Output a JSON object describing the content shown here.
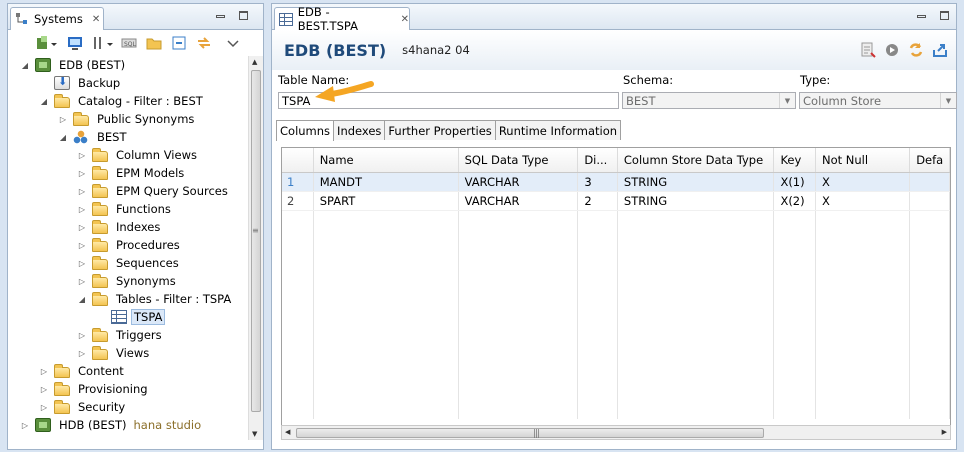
{
  "systems_view": {
    "tab_label": "Systems",
    "tree": [
      {
        "label": "EDB (BEST)",
        "level": 0,
        "icon": "database-icon",
        "toggle": "expanded"
      },
      {
        "label": "Backup",
        "level": 1,
        "icon": "backup-icon",
        "toggle": "none"
      },
      {
        "label": "Catalog - Filter : BEST",
        "level": 1,
        "icon": "folder-icon",
        "toggle": "expanded"
      },
      {
        "label": "Public Synonyms",
        "level": 2,
        "icon": "folder-icon",
        "toggle": "collapsed"
      },
      {
        "label": "BEST",
        "level": 2,
        "icon": "schema-icon",
        "toggle": "expanded"
      },
      {
        "label": "Column Views",
        "level": 3,
        "icon": "folder-icon",
        "toggle": "collapsed"
      },
      {
        "label": "EPM Models",
        "level": 3,
        "icon": "folder-icon",
        "toggle": "collapsed"
      },
      {
        "label": "EPM Query Sources",
        "level": 3,
        "icon": "folder-icon",
        "toggle": "collapsed"
      },
      {
        "label": "Functions",
        "level": 3,
        "icon": "folder-icon",
        "toggle": "collapsed"
      },
      {
        "label": "Indexes",
        "level": 3,
        "icon": "folder-icon",
        "toggle": "collapsed"
      },
      {
        "label": "Procedures",
        "level": 3,
        "icon": "folder-icon",
        "toggle": "collapsed"
      },
      {
        "label": "Sequences",
        "level": 3,
        "icon": "folder-icon",
        "toggle": "collapsed"
      },
      {
        "label": "Synonyms",
        "level": 3,
        "icon": "folder-icon",
        "toggle": "collapsed"
      },
      {
        "label": "Tables - Filter : TSPA",
        "level": 3,
        "icon": "folder-icon",
        "toggle": "expanded"
      },
      {
        "label": "TSPA",
        "level": 4,
        "icon": "table-icon",
        "toggle": "none",
        "selected": true
      },
      {
        "label": "Triggers",
        "level": 3,
        "icon": "folder-icon",
        "toggle": "collapsed"
      },
      {
        "label": "Views",
        "level": 3,
        "icon": "folder-icon",
        "toggle": "collapsed"
      },
      {
        "label": "Content",
        "level": 1,
        "icon": "folder-icon",
        "toggle": "collapsed"
      },
      {
        "label": "Provisioning",
        "level": 1,
        "icon": "folder-icon",
        "toggle": "collapsed"
      },
      {
        "label": "Security",
        "level": 1,
        "icon": "folder-icon",
        "toggle": "collapsed"
      },
      {
        "label": "HDB (BEST)",
        "level": 0,
        "icon": "database-icon",
        "toggle": "collapsed",
        "suffix": "hana studio"
      }
    ]
  },
  "editor": {
    "tab_label": "EDB - BEST.TSPA",
    "title": "EDB (BEST)",
    "subtitle": "s4hana2 04",
    "table_name_label": "Table Name:",
    "table_name_value": "TSPA",
    "schema_label": "Schema:",
    "schema_value": "BEST",
    "type_label": "Type:",
    "type_value": "Column Store",
    "subtabs": [
      "Columns",
      "Indexes",
      "Further Properties",
      "Runtime Information"
    ],
    "active_subtab": "Columns",
    "columns_header": [
      "Name",
      "SQL Data Type",
      "Di...",
      "Column Store Data Type",
      "Key",
      "Not Null",
      "Defa"
    ],
    "rows": [
      [
        "1",
        "MANDT",
        "VARCHAR",
        "3",
        "STRING",
        "X(1)",
        "X",
        ""
      ],
      [
        "2",
        "SPART",
        "VARCHAR",
        "2",
        "STRING",
        "X(2)",
        "X",
        ""
      ]
    ]
  },
  "colors": {
    "title": "#1f4a7a",
    "highlight_row": "#e3edf9",
    "arrow": "#f5a623"
  }
}
